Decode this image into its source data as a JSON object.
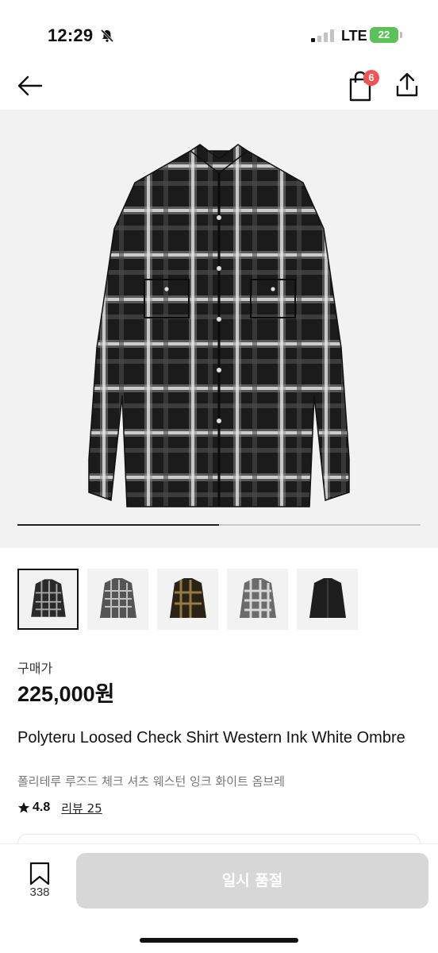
{
  "status_bar": {
    "time": "12:29",
    "network": "LTE",
    "battery": "22"
  },
  "nav": {
    "bag_count": "6",
    "icons": [
      "back-arrow-icon",
      "shopping-bag-icon",
      "share-icon"
    ]
  },
  "gallery": {
    "progress": 0.5,
    "thumbnails": [
      {
        "name": "thumbnail-black-white-ombre",
        "active": true
      },
      {
        "name": "thumbnail-grey-check",
        "active": false
      },
      {
        "name": "thumbnail-brown-check",
        "active": false
      },
      {
        "name": "thumbnail-light-check",
        "active": false
      },
      {
        "name": "thumbnail-black-solid",
        "active": false
      }
    ]
  },
  "product": {
    "price_label": "구매가",
    "price": "225,000원",
    "title": "Polyteru Loosed Check Shirt Western Ink White Ombre",
    "subtitle": "폴리테루 루즈드 체크 셔츠 웨스턴 잉크 화이트 옴브레",
    "rating": "4.8",
    "review_link": "리뷰 25"
  },
  "bottom_bar": {
    "like_count": "338",
    "button_label": "일시 품절"
  },
  "colors": {
    "badge": "#f05454",
    "battery": "#5bc25a",
    "disabled_button": "#d7d7d7"
  }
}
